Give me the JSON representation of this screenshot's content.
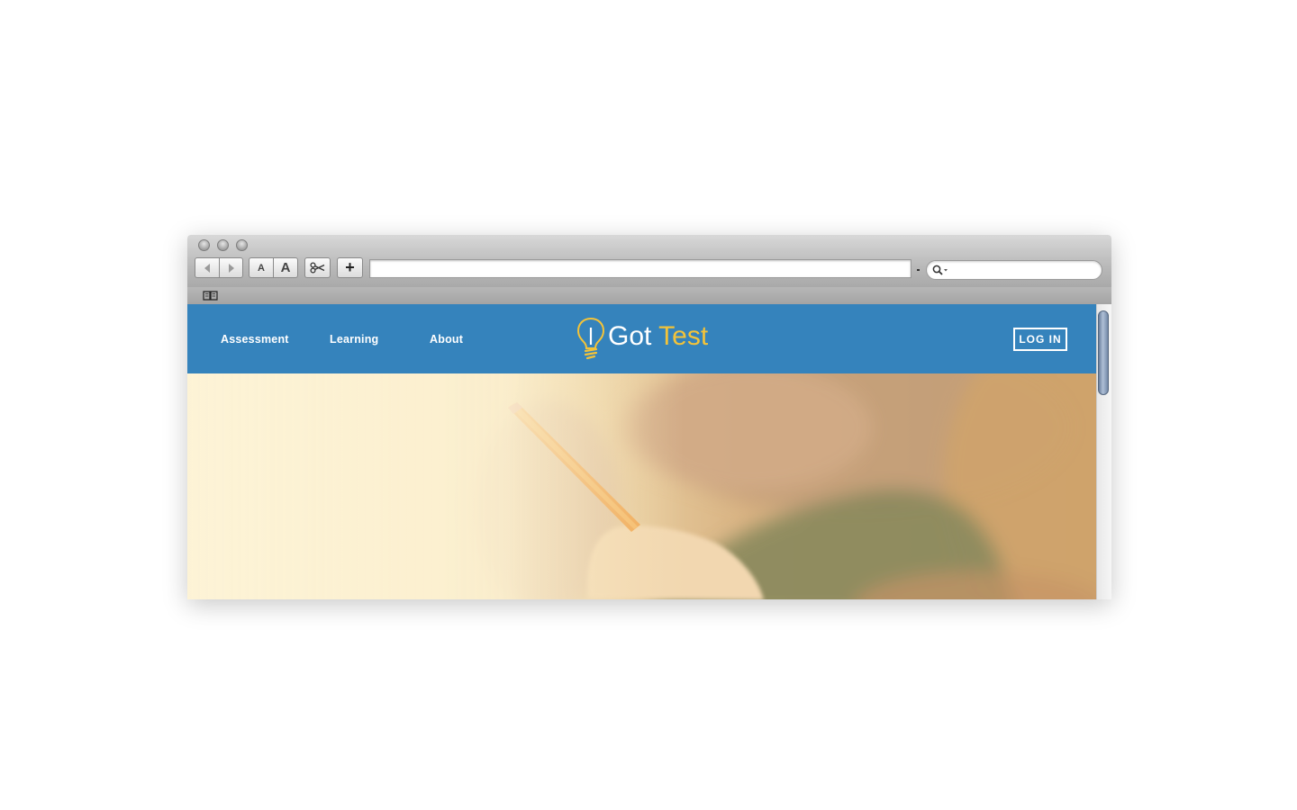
{
  "browser": {
    "toolbar": {
      "text_smaller_label": "A",
      "text_bigger_label": "A",
      "add_label": "+",
      "address_value": "",
      "search_value": ""
    }
  },
  "site": {
    "nav": [
      {
        "label": "Assessment"
      },
      {
        "label": "Learning"
      },
      {
        "label": "About"
      }
    ],
    "logo": {
      "word1": "Got",
      "word2": "Test"
    },
    "login_label": "LOG IN"
  },
  "colors": {
    "header_blue": "#3583bc",
    "logo_accent": "#f3c339",
    "hero_cream": "#fcf1d3"
  }
}
